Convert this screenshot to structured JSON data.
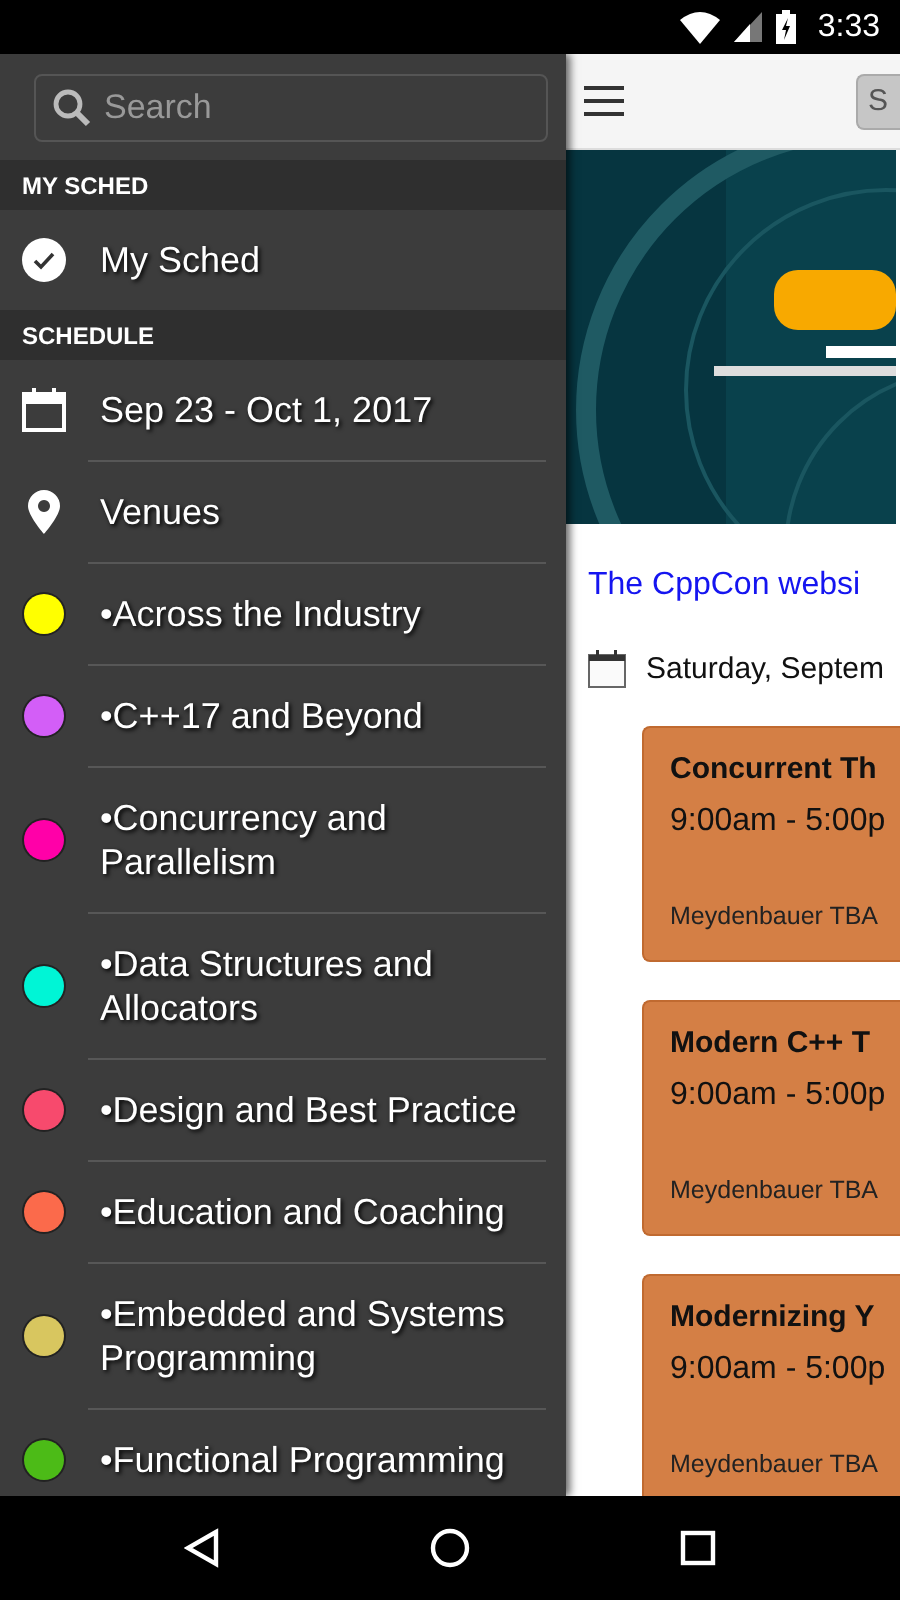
{
  "status_bar": {
    "time": "3:33"
  },
  "drawer": {
    "search": {
      "placeholder": "Search"
    },
    "sections": [
      {
        "header": "MY SCHED",
        "items": [
          {
            "kind": "check",
            "label": "My Sched"
          }
        ]
      },
      {
        "header": "SCHEDULE",
        "items": [
          {
            "kind": "calendar",
            "label": "Sep 23 - Oct 1, 2017"
          },
          {
            "kind": "pin",
            "label": "Venues"
          },
          {
            "kind": "track",
            "label": "•Across the Industry",
            "color": "#ffff00"
          },
          {
            "kind": "track",
            "label": "•C++17 and Beyond",
            "color": "#d35ef7"
          },
          {
            "kind": "track",
            "label": "•Concurrency and Parallelism",
            "color": "#ff00a8"
          },
          {
            "kind": "track",
            "label": "•Data Structures and Allocators",
            "color": "#00f5d6"
          },
          {
            "kind": "track",
            "label": "•Design and Best Practice",
            "color": "#f74a6d"
          },
          {
            "kind": "track",
            "label": "•Education and Coaching",
            "color": "#fb6a4b"
          },
          {
            "kind": "track",
            "label": "•Embedded and Systems Programming",
            "color": "#d8c65f"
          },
          {
            "kind": "track",
            "label": "•Functional Programming",
            "color": "#4cbb17"
          }
        ]
      }
    ]
  },
  "main": {
    "toolbar": {
      "button": "S"
    },
    "link": "The CppCon websi",
    "date": "Saturday, Septem",
    "sessions": [
      {
        "title": "Concurrent Th",
        "time": "9:00am - 5:00p",
        "venue": "Meydenbauer TBA"
      },
      {
        "title": "Modern C++ T",
        "time": "9:00am - 5:00p",
        "venue": "Meydenbauer TBA"
      },
      {
        "title": "Modernizing Y",
        "time": "9:00am - 5:00p",
        "venue": "Meydenbauer TBA"
      }
    ]
  }
}
